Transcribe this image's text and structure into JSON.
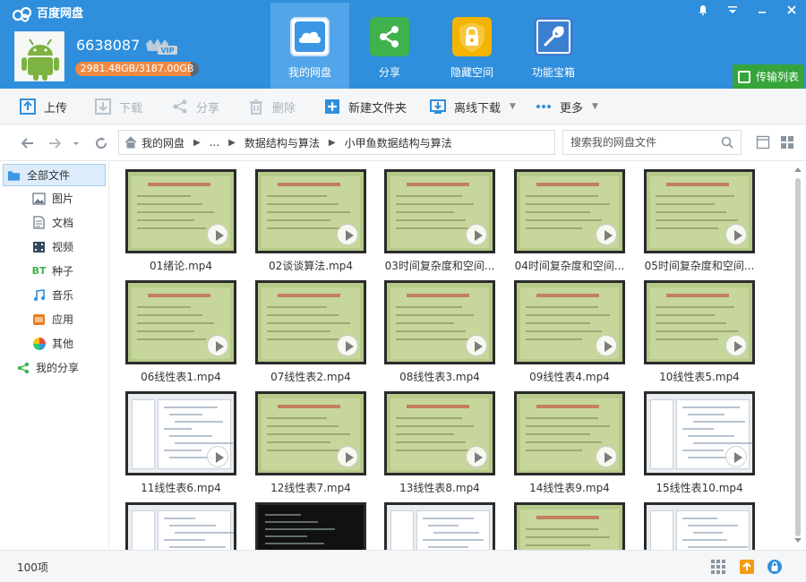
{
  "app": {
    "title": "百度网盘"
  },
  "user": {
    "name": "6638087",
    "vip_label": "VIP",
    "quota_text": "2981.48GB/3187.00GB",
    "quota_used_fraction": 0.935
  },
  "main_tabs": [
    {
      "label": "我的网盘",
      "icon": "cloud-icon",
      "active": true
    },
    {
      "label": "分享",
      "icon": "share-icon",
      "active": false
    },
    {
      "label": "隐藏空间",
      "icon": "lock-icon",
      "active": false
    },
    {
      "label": "功能宝箱",
      "icon": "wrench-icon",
      "active": false
    }
  ],
  "transfer_label": "传输列表",
  "toolbar": {
    "upload": "上传",
    "download": "下载",
    "share": "分享",
    "delete": "删除",
    "new_folder": "新建文件夹",
    "offline_download": "离线下载",
    "more": "更多"
  },
  "breadcrumb": {
    "root": "我的网盘",
    "ellipsis": "...",
    "level1": "数据结构与算法",
    "level2": "小甲鱼数据结构与算法"
  },
  "search": {
    "placeholder": "搜索我的网盘文件"
  },
  "sidebar": {
    "items": [
      {
        "label": "全部文件",
        "icon": "folder-icon"
      },
      {
        "label": "图片",
        "icon": "image-icon"
      },
      {
        "label": "文档",
        "icon": "document-icon"
      },
      {
        "label": "视频",
        "icon": "video-icon"
      },
      {
        "label": "种子",
        "icon": "bt-icon",
        "icon_text": "BT"
      },
      {
        "label": "音乐",
        "icon": "music-icon"
      },
      {
        "label": "应用",
        "icon": "app-icon"
      },
      {
        "label": "其他",
        "icon": "other-icon"
      },
      {
        "label": "我的分享",
        "icon": "share-icon"
      }
    ]
  },
  "files": [
    {
      "name": "01绪论.mp4",
      "thumb": "slide"
    },
    {
      "name": "02谈谈算法.mp4",
      "thumb": "slide"
    },
    {
      "name": "03时间复杂度和空间...",
      "thumb": "slide"
    },
    {
      "name": "04时间复杂度和空间...",
      "thumb": "slide"
    },
    {
      "name": "05时间复杂度和空间...",
      "thumb": "slide"
    },
    {
      "name": "06线性表1.mp4",
      "thumb": "slide"
    },
    {
      "name": "07线性表2.mp4",
      "thumb": "slide"
    },
    {
      "name": "08线性表3.mp4",
      "thumb": "slide"
    },
    {
      "name": "09线性表4.mp4",
      "thumb": "slide"
    },
    {
      "name": "10线性表5.mp4",
      "thumb": "slide"
    },
    {
      "name": "11线性表6.mp4",
      "thumb": "code"
    },
    {
      "name": "12线性表7.mp4",
      "thumb": "slide"
    },
    {
      "name": "13线性表8.mp4",
      "thumb": "slide"
    },
    {
      "name": "14线性表9.mp4",
      "thumb": "slide"
    },
    {
      "name": "15线性表10.mp4",
      "thumb": "code"
    },
    {
      "name": "",
      "thumb": "code"
    },
    {
      "name": "",
      "thumb": "term"
    },
    {
      "name": "",
      "thumb": "code"
    },
    {
      "name": "",
      "thumb": "slide"
    },
    {
      "name": "",
      "thumb": "code"
    }
  ],
  "status": {
    "count": "100项"
  },
  "colors": {
    "header": "#2f8fdc",
    "active_tab": "#52a5e8",
    "transfer": "#36a43b",
    "quota_fill": "#f08a43"
  }
}
